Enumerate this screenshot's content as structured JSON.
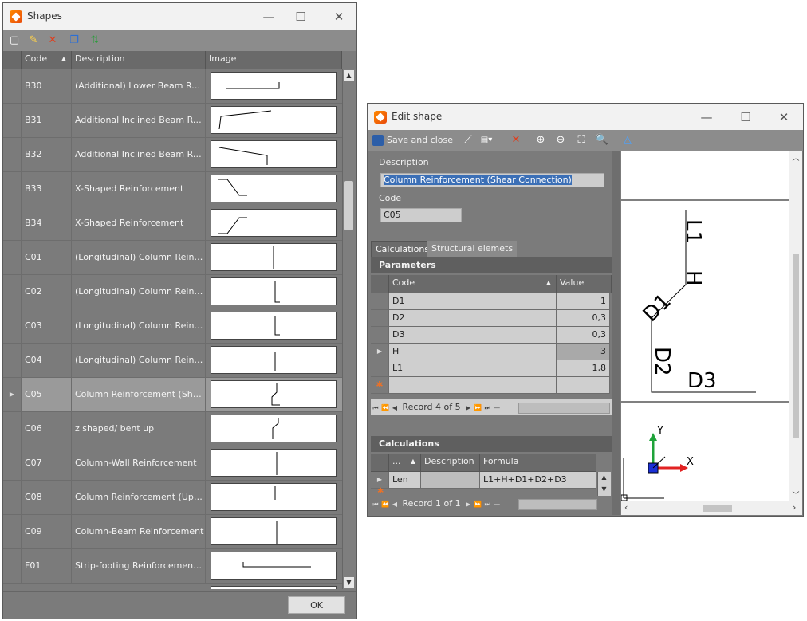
{
  "shapes_window": {
    "title": "Shapes",
    "columns": {
      "code": "Code",
      "description": "Description",
      "image": "Image"
    },
    "rows": [
      {
        "code": "B30",
        "description": "(Additional) Lower Beam Reinfo..."
      },
      {
        "code": "B31",
        "description": "Additional Inclined Beam Reinfo..."
      },
      {
        "code": "B32",
        "description": "Additional Inclined Beam Reinfo..."
      },
      {
        "code": "B33",
        "description": "X-Shaped Reinforcement"
      },
      {
        "code": "B34",
        "description": "X-Shaped Reinforcement"
      },
      {
        "code": "C01",
        "description": "(Longitudinal) Column Reinforc..."
      },
      {
        "code": "C02",
        "description": "(Longitudinal) Column Reinforc..."
      },
      {
        "code": "C03",
        "description": "(Longitudinal) Column Reinforc..."
      },
      {
        "code": "C04",
        "description": "(Longitudinal) Column Reinforc..."
      },
      {
        "code": "C05",
        "description": "Column Reinforcement (Shear ..."
      },
      {
        "code": "C06",
        "description": "z shaped/ bent up"
      },
      {
        "code": "C07",
        "description": "Column-Wall Reinforcement"
      },
      {
        "code": "C08",
        "description": "Column Reinforcement (Upper ..."
      },
      {
        "code": "C09",
        "description": "Column-Beam Reinforcement"
      },
      {
        "code": "F01",
        "description": "Strip-footing Reinforcement (Lo..."
      }
    ],
    "ok_label": "OK"
  },
  "edit_window": {
    "title": "Edit shape",
    "save_close_label": "Save and close",
    "description_label": "Description",
    "description_value": "Column Reinforcement (Shear Connection)",
    "code_label": "Code",
    "code_value": "C05",
    "tabs": [
      "Calculations",
      "Structural elemets"
    ],
    "parameters_title": "Parameters",
    "param_columns": {
      "code": "Code",
      "value": "Value"
    },
    "params": [
      {
        "code": "D1",
        "value": "1"
      },
      {
        "code": "D2",
        "value": "0,3"
      },
      {
        "code": "D3",
        "value": "0,3"
      },
      {
        "code": "H",
        "value": "3"
      },
      {
        "code": "L1",
        "value": "1,8"
      }
    ],
    "param_nav": "Record 4 of 5",
    "calculations_title": "Calculations",
    "calc_columns": {
      "dots": "...",
      "description": "Description",
      "formula": "Formula"
    },
    "calc_rows": [
      {
        "name": "Len",
        "description": "",
        "formula": "L1+H+D1+D2+D3"
      }
    ],
    "calc_nav": "Record 1 of 1",
    "drawing_labels": {
      "l1": "L1",
      "h": "H",
      "d1": "D1",
      "d2": "D2",
      "d3": "D3",
      "axis_x": "X",
      "axis_y": "Y"
    }
  }
}
